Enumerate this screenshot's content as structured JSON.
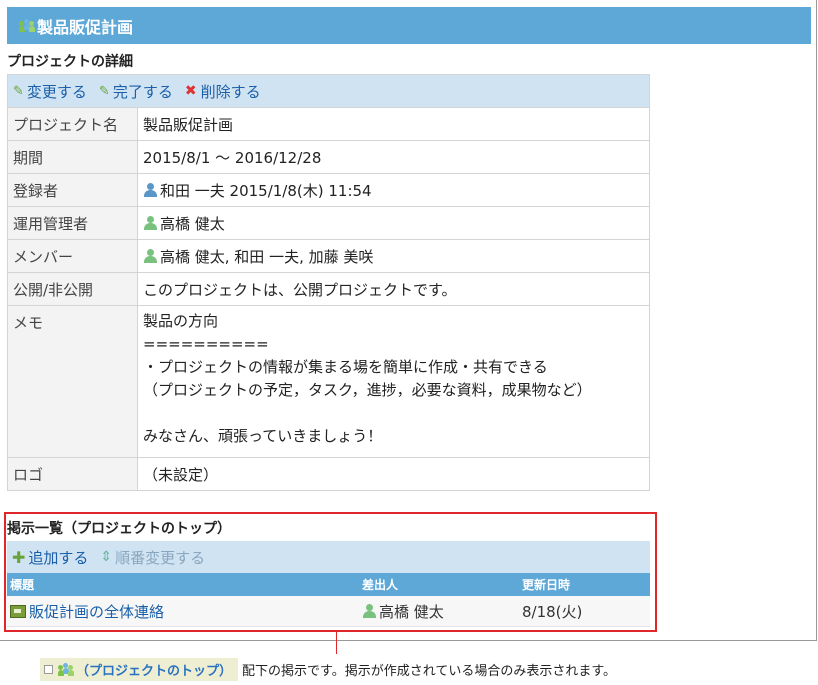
{
  "header": {
    "title": "製品販促計画"
  },
  "details_section": {
    "title": "プロジェクトの詳細"
  },
  "toolbar": {
    "edit": "変更する",
    "complete": "完了する",
    "delete": "削除する"
  },
  "details": {
    "project_name_label": "プロジェクト名",
    "project_name": "製品販促計画",
    "period_label": "期間",
    "period": "2015/8/1 ～ 2016/12/28",
    "registrant_label": "登録者",
    "registrant": "和田 一夫 2015/1/8(木) 11:54",
    "manager_label": "運用管理者",
    "manager": "高橋 健太",
    "members_label": "メンバー",
    "members": "高橋 健太, 和田 一夫, 加藤 美咲",
    "visibility_label": "公開/非公開",
    "visibility": "このプロジェクトは、公開プロジェクトです。",
    "memo_label": "メモ",
    "memo": "製品の方向\n==========\n・プロジェクトの情報が集まる場を簡単に作成・共有できる\n（プロジェクトの予定，タスク，進捗，必要な資料，成果物など）\n\nみなさん、頑張っていきましょう！",
    "logo_label": "ロゴ",
    "logo": "（未設定）"
  },
  "board": {
    "title": "掲示一覧（プロジェクトのトップ）",
    "add": "追加する",
    "reorder": "順番変更する",
    "columns": {
      "title": "標題",
      "sender": "差出人",
      "updated": "更新日時"
    },
    "rows": [
      {
        "title": "販促計画の全体連絡",
        "sender": "高橋 健太",
        "updated": "8/18(火)"
      }
    ]
  },
  "note": {
    "chip": "（プロジェクトのトップ）",
    "text": "配下の掲示です。掲示が作成されている場合のみ表示されます。"
  }
}
